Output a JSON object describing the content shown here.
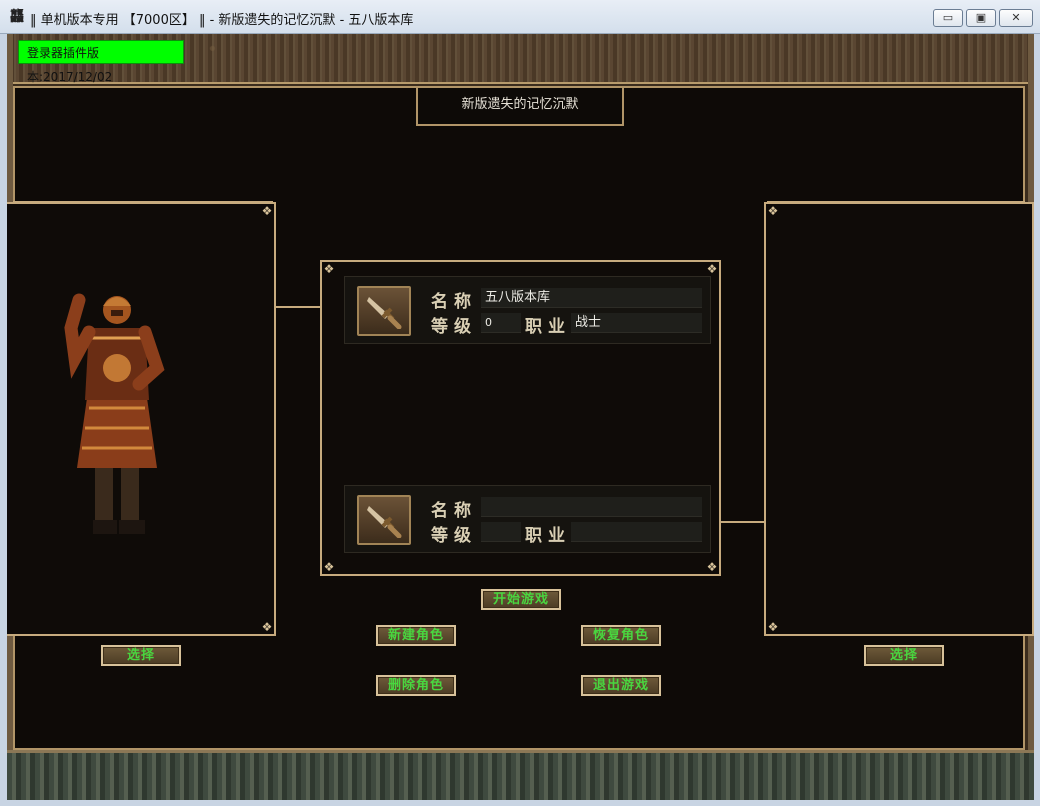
{
  "window": {
    "title": "‖ 单机版本专用 【7000区】 ‖ - 新版遗失的记忆沉默 - 五八版本库",
    "app_icon": "龘",
    "minimize": "▭",
    "maximize": "▣",
    "close": "✕"
  },
  "version_badge": "登录器插件版本:2017/12/02",
  "server_name": "新版遗失的记忆沉默",
  "slots": [
    {
      "name_label": "名称",
      "name_value": "五八版本库",
      "level_label": "等级",
      "level_value": "0",
      "job_label": "职业",
      "job_value": "战士"
    },
    {
      "name_label": "名称",
      "name_value": "",
      "level_label": "等级",
      "level_value": "",
      "job_label": "职业",
      "job_value": ""
    }
  ],
  "buttons": {
    "select_left": "选择",
    "select_right": "选择",
    "start_game": "开始游戏",
    "new_role": "新建角色",
    "restore_role": "恢复角色",
    "delete_role": "删除角色",
    "exit_game": "退出游戏"
  },
  "colors": {
    "accent_green": "#00ff00",
    "button_text": "#49d63f",
    "frame_gold": "#c7ab7e"
  },
  "icons": [
    "sword-icon",
    "warrior-character"
  ]
}
